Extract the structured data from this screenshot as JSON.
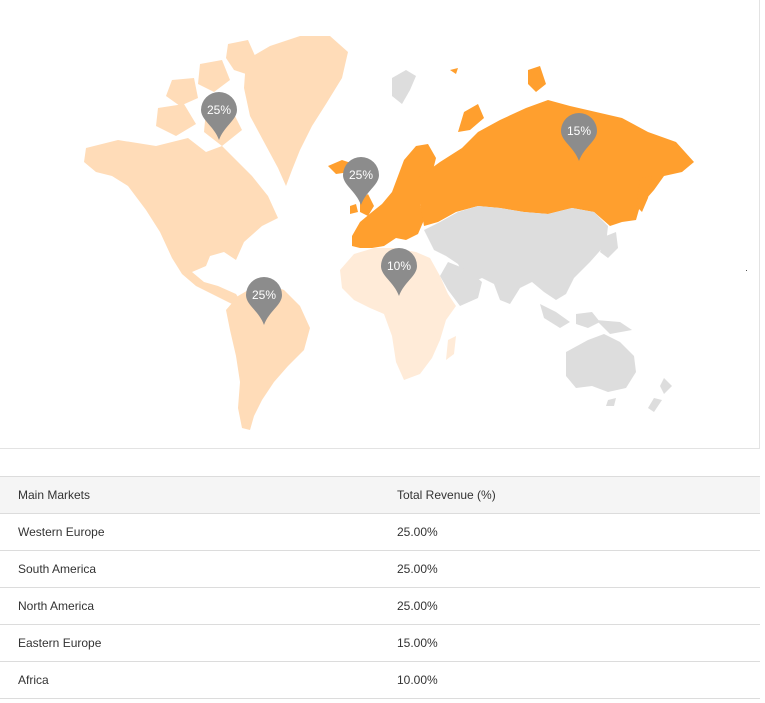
{
  "map": {
    "colors": {
      "high": "#FF9F2E",
      "mid": "#FFDCB8",
      "low": "#FFEBD8",
      "none": "#DDDDDD",
      "pin": "#8C8C8C"
    },
    "pins": [
      {
        "region": "North America",
        "label": "25%",
        "icon": "map-pin-icon"
      },
      {
        "region": "Western Europe",
        "label": "25%",
        "icon": "map-pin-icon"
      },
      {
        "region": "Eastern Europe",
        "label": "15%",
        "icon": "map-pin-icon"
      },
      {
        "region": "Africa",
        "label": "10%",
        "icon": "map-pin-icon"
      },
      {
        "region": "South America",
        "label": "25%",
        "icon": "map-pin-icon"
      }
    ]
  },
  "table": {
    "headers": [
      "Main Markets",
      "Total Revenue (%)"
    ],
    "rows": [
      [
        "Western Europe",
        "25.00%"
      ],
      [
        "South America",
        "25.00%"
      ],
      [
        "North America",
        "25.00%"
      ],
      [
        "Eastern Europe",
        "15.00%"
      ],
      [
        "Africa",
        "10.00%"
      ]
    ]
  }
}
